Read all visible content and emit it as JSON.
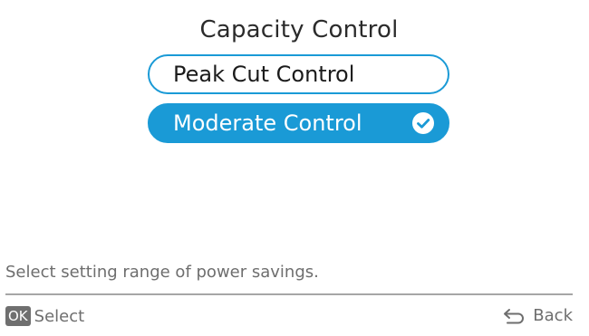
{
  "header": {
    "title": "Capacity Control"
  },
  "options": [
    {
      "label": "Peak Cut Control",
      "selected": false
    },
    {
      "label": "Moderate Control",
      "selected": true
    }
  ],
  "hint": "Select setting range of power savings.",
  "footer": {
    "ok_badge": "OK",
    "select_label": "Select",
    "back_label": "Back"
  },
  "icons": {
    "selected": "check-circle-icon",
    "back": "back-arrow-icon"
  },
  "colors": {
    "accent": "#1a9ad6",
    "text_muted": "#6e6e6e",
    "badge_bg": "#6f6f6f"
  }
}
